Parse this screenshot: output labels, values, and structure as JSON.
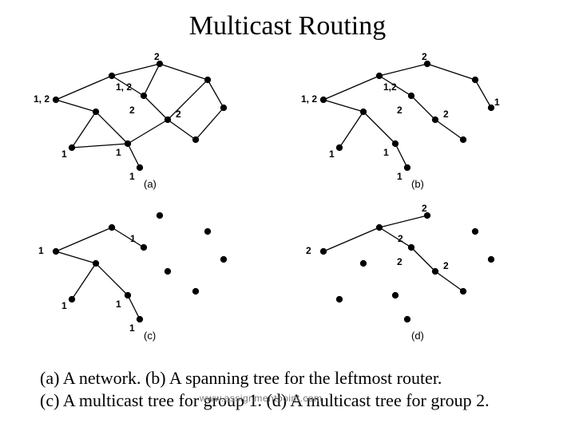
{
  "title": "Multicast Routing",
  "caption_line1": "(a) A network.   (b) A spanning tree for the leftmost router.",
  "caption_line2": " (c) A multicast tree for group 1.   (d) A multicast tree for group 2.",
  "watermark": "www.assignmentpoint.com",
  "node_labels": {
    "n_1_2": "1, 2",
    "n_1c2": "1,2",
    "n_1": "1",
    "n_2": "2"
  },
  "panel_labels": {
    "a": "(a)",
    "b": "(b)",
    "c": "(c)",
    "d": "(d)"
  }
}
